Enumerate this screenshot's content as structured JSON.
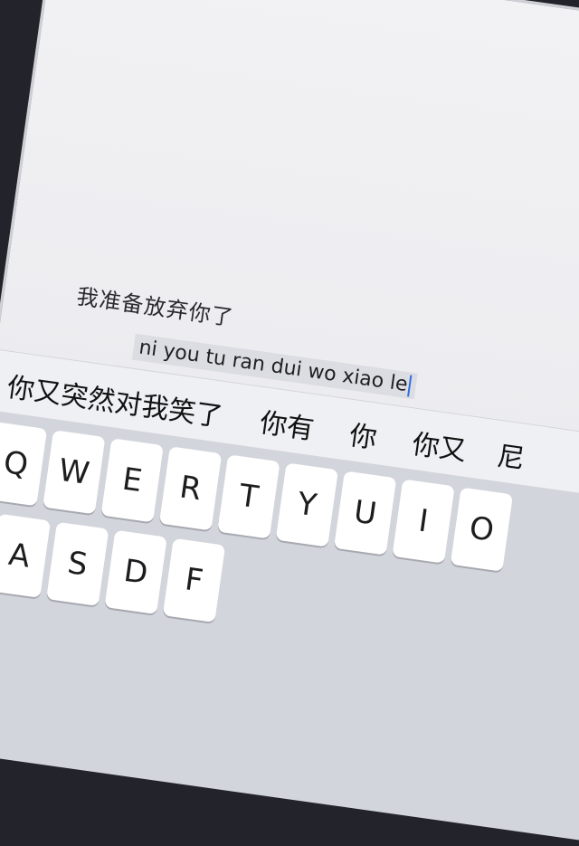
{
  "editor": {
    "composed_text": "我准备放弃你了",
    "pinyin_input": "ni you tu ran dui wo xiao le"
  },
  "candidates": [
    "你又突然对我笑了",
    "你有",
    "你",
    "你又",
    "尼"
  ],
  "keyboard": {
    "row1": [
      "Q",
      "W",
      "E",
      "R",
      "T",
      "Y",
      "U",
      "I",
      "O"
    ],
    "row2": [
      "A",
      "S",
      "D",
      "F"
    ]
  }
}
